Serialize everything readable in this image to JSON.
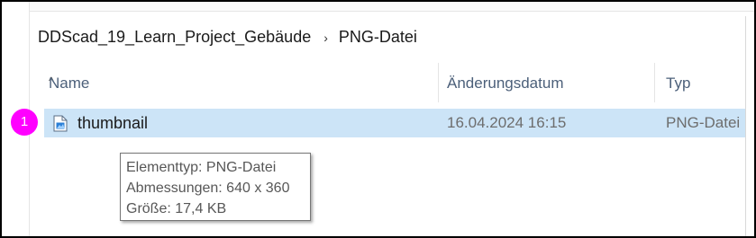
{
  "breadcrumb": {
    "items": [
      "DDScad_19_Learn_Project_Gebäude",
      "PNG-Datei"
    ],
    "separator": "›"
  },
  "columns": {
    "name": "Name",
    "date": "Änderungsdatum",
    "type": "Typ",
    "sort_indicator": "^"
  },
  "files": [
    {
      "name": "thumbnail",
      "modified": "16.04.2024 16:15",
      "type": "PNG-Datei",
      "icon": "png-file-icon",
      "selected": true
    }
  ],
  "tooltip": {
    "lines": [
      "Elementtyp: PNG-Datei",
      "Abmessungen: 640 x 360",
      "Größe: 17,4 KB"
    ]
  },
  "callout": {
    "label": "1",
    "color": "#ff00ff"
  },
  "colors": {
    "selection": "#cce4f7",
    "header_text": "#4c607a"
  }
}
